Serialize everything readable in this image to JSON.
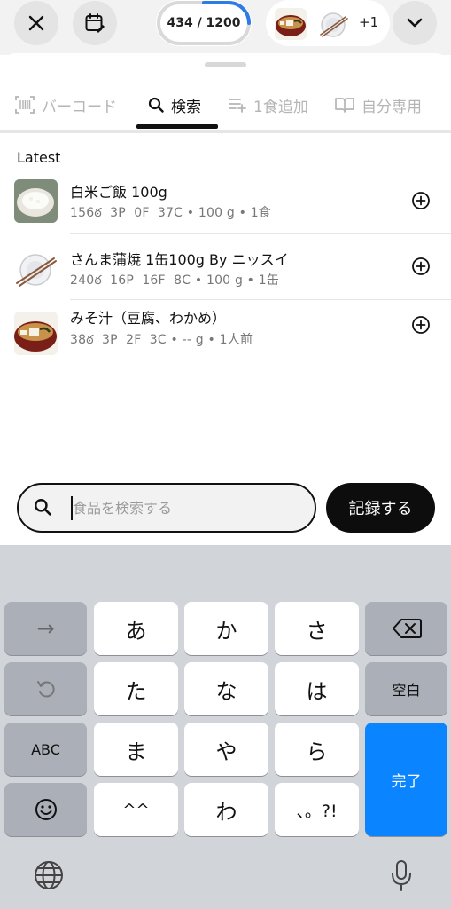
{
  "header": {
    "close_icon": "close-icon",
    "calendar_icon": "calendar-edit-icon",
    "calories": "434 / 1200",
    "calorie_progress": 0.36,
    "extra_count": "+1",
    "expand_icon": "chevron-down-icon"
  },
  "tabs": [
    {
      "label": "バーコード",
      "icon": "barcode-icon",
      "active": false
    },
    {
      "label": "検索",
      "icon": "search-icon",
      "active": true
    },
    {
      "label": "1食追加",
      "icon": "list-add-icon",
      "active": false
    },
    {
      "label": "自分専用",
      "icon": "book-icon",
      "active": false
    }
  ],
  "section_title": "Latest",
  "foods": [
    {
      "name": "白米ご飯 100g",
      "cal": "156",
      "p": "3P",
      "f": "0F",
      "c": "37C",
      "amount": "100 g",
      "unit": "1食"
    },
    {
      "name": "さんま蒲焼 1缶100g By ニッスイ",
      "cal": "240",
      "p": "16P",
      "f": "16F",
      "c": "8C",
      "amount": "100 g",
      "unit": "1缶"
    },
    {
      "name": "みそ汁（豆腐、わかめ）",
      "cal": "38",
      "p": "3P",
      "f": "2F",
      "c": "3C",
      "amount": "-- g",
      "unit": "1人前"
    }
  ],
  "search": {
    "placeholder": "食品を検索する",
    "value": ""
  },
  "record_button": "記録する",
  "keyboard": {
    "row1": [
      "→",
      "あ",
      "か",
      "さ"
    ],
    "row2": [
      "た",
      "な",
      "は",
      "空白"
    ],
    "row3": [
      "ABC",
      "ま",
      "や",
      "ら"
    ],
    "row4": [
      "^^",
      "わ",
      "、。?!"
    ],
    "done": "完了"
  },
  "colors": {
    "accent": "#0a84ff",
    "ring": "#2f7be6",
    "dark": "#0d0d0d"
  }
}
